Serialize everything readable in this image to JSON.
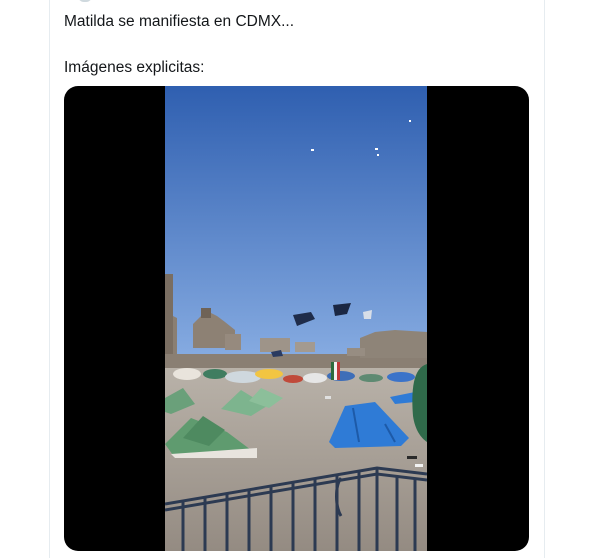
{
  "tweet": {
    "text_line1": "Matilda se manifiesta en CDMX...",
    "text_line2": "Imágenes explicitas:"
  },
  "media": {
    "type": "video",
    "description_icon": "video-frame",
    "colors": {
      "sky": "#3d6fb8",
      "plaza": "#a59c92",
      "tent_blue": "#2f7bd6",
      "tent_green": "#7fb38c",
      "fence": "#2c3a52"
    }
  }
}
